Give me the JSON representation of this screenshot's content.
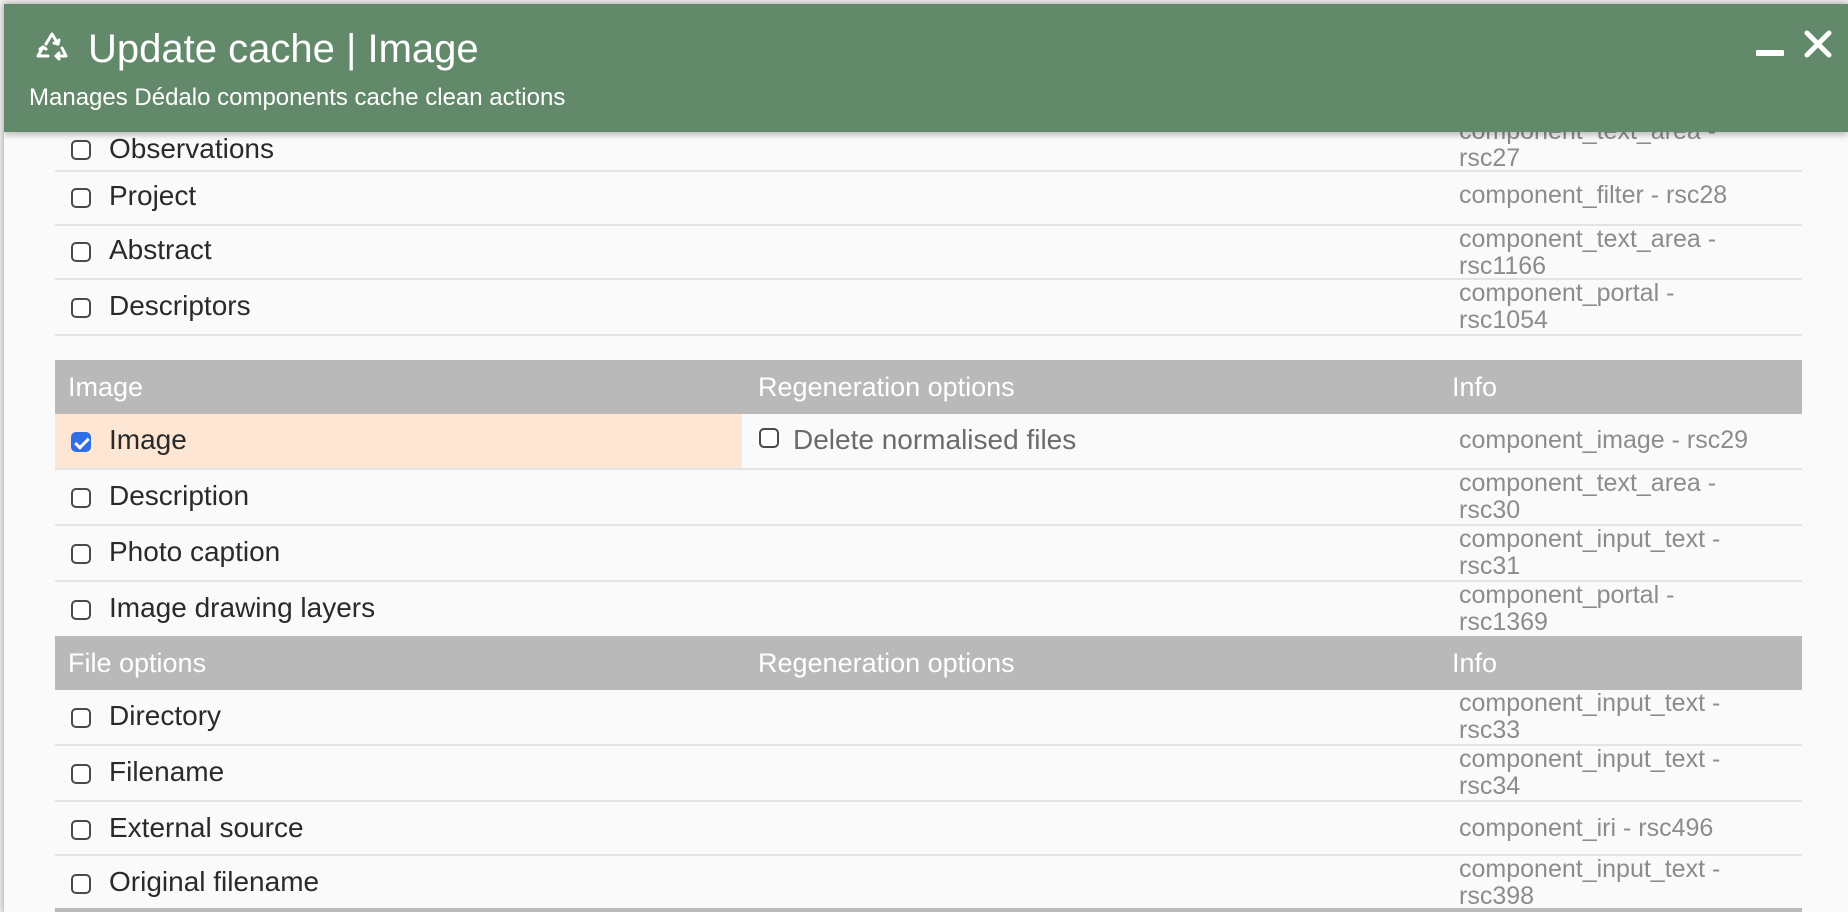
{
  "header": {
    "title": "Update cache | Image",
    "subtitle": "Manages Dédalo components cache clean actions",
    "icon": "recycle-icon",
    "color": "#63896b"
  },
  "rows_top": [
    {
      "label": "Observations",
      "info_line1": "component_text_area -",
      "info_line2": "rsc27"
    },
    {
      "label": "Project",
      "info_line1": "component_filter - rsc28",
      "info_line2": ""
    },
    {
      "label": "Abstract",
      "info_line1": "component_text_area -",
      "info_line2": "rsc1166"
    },
    {
      "label": "Descriptors",
      "info_line1": "component_portal -",
      "info_line2": "rsc1054"
    }
  ],
  "section_image": {
    "col1": "Image",
    "col2": "Regeneration options",
    "col3": "Info"
  },
  "rows_image": [
    {
      "label": "Image",
      "checked": true,
      "regen_label": "Delete normalised files",
      "info_line1": "component_image - rsc29",
      "info_line2": ""
    },
    {
      "label": "Description",
      "info_line1": "component_text_area -",
      "info_line2": "rsc30"
    },
    {
      "label": "Photo caption",
      "info_line1": "component_input_text -",
      "info_line2": "rsc31"
    },
    {
      "label": "Image drawing layers",
      "info_line1": "component_portal -",
      "info_line2": "rsc1369"
    }
  ],
  "section_file": {
    "col1": "File options",
    "col2": "Regeneration options",
    "col3": "Info"
  },
  "rows_file": [
    {
      "label": "Directory",
      "info_line1": "component_input_text -",
      "info_line2": "rsc33"
    },
    {
      "label": "Filename",
      "info_line1": "component_input_text -",
      "info_line2": "rsc34"
    },
    {
      "label": "External source",
      "info_line1": "component_iri - rsc496",
      "info_line2": ""
    },
    {
      "label": "Original filename",
      "info_line1": "component_input_text -",
      "info_line2": "rsc398"
    }
  ]
}
